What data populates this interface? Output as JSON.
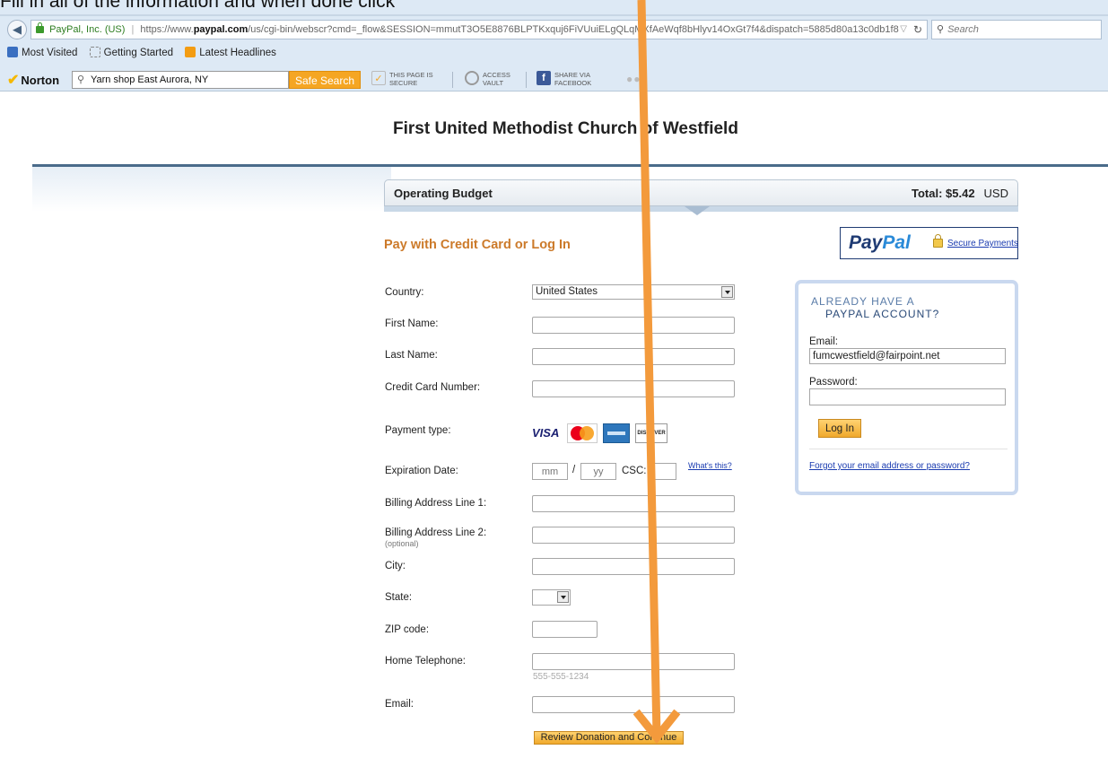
{
  "annotation": {
    "caption": "Fill in all of the information and when done click"
  },
  "browser": {
    "site_identity": "PayPal, Inc. (US)",
    "url_prefix": "https://www.",
    "url_domain": "paypal.com",
    "url_path": "/us/cgi-bin/webscr?cmd=_flow&SESSION=mmutT3O5E8876BLPTKxquj6FiVUuiELgQLqMXfAeWqf8bHlyv14OxGt7f4&dispatch=5885d80a13c0db1f8",
    "search_placeholder": "Search",
    "bookmarks": [
      "Most Visited",
      "Getting Started",
      "Latest Headlines"
    ]
  },
  "norton": {
    "logo": "Norton",
    "search_value": "Yarn shop East Aurora, NY",
    "safe_search_label": "Safe Search",
    "secure_line1": "THIS PAGE IS",
    "secure_line2": "SECURE",
    "vault_line1": "ACCESS",
    "vault_line2": "VAULT",
    "share_line1": "SHARE VIA",
    "share_line2": "FACEBOOK"
  },
  "page": {
    "merchant_name": "First United Methodist Church of Westfield",
    "cart": {
      "item": "Operating Budget",
      "total_label": "Total: $5.42",
      "currency": "USD"
    },
    "heading": "Pay with Credit Card or Log In",
    "paypal_logo_a": "Pay",
    "paypal_logo_b": "Pal",
    "secure_payments": "Secure Payments"
  },
  "form": {
    "country_label": "Country:",
    "country_value": "United States",
    "first_name_label": "First Name:",
    "last_name_label": "Last Name:",
    "card_number_label": "Credit Card Number:",
    "payment_type_label": "Payment type:",
    "card_brands": {
      "visa": "VISA",
      "discover_a": "DISC",
      "discover_b": "O",
      "discover_c": "VER"
    },
    "expiration_label": "Expiration Date:",
    "exp_month_placeholder": "mm",
    "exp_year_placeholder": "yy",
    "exp_separator": "/",
    "csc_label": "CSC:",
    "whats_this": "What's this?",
    "billing1_label": "Billing Address Line 1:",
    "billing2_label": "Billing Address Line 2:",
    "billing2_note": "(optional)",
    "city_label": "City:",
    "state_label": "State:",
    "zip_label": "ZIP code:",
    "phone_label": "Home Telephone:",
    "phone_hint": "555-555-1234",
    "email_label": "Email:",
    "review_button": "Review Donation and Continue"
  },
  "login": {
    "heading_line1": "ALREADY HAVE A",
    "heading_line2": "PAYPAL ACCOUNT?",
    "email_label": "Email:",
    "email_value": "fumcwestfield@fairpoint.net",
    "password_label": "Password:",
    "login_button": "Log In",
    "forgot_link": "Forgot your email address or password?"
  },
  "colors": {
    "annotation_arrow": "#f39a3c",
    "heading_orange": "#cc7a2a",
    "paypal_navy": "#1f3b73",
    "paypal_blue": "#2a8ad8",
    "button_orange": "#f0a92c"
  }
}
